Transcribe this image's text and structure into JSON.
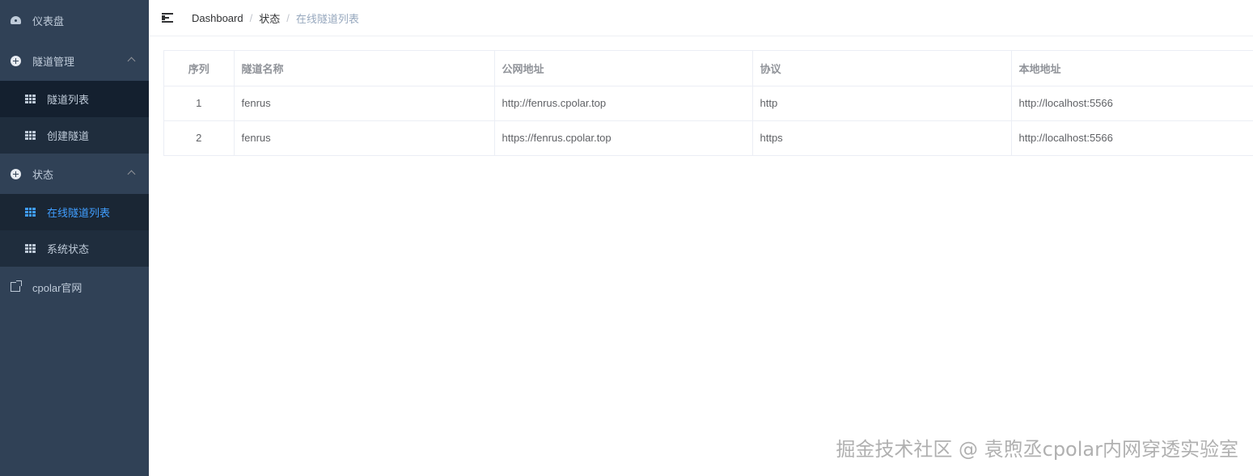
{
  "sidebar": {
    "dashboard": {
      "label": "仪表盘",
      "icon": "dashboard-gauge-icon"
    },
    "tunnel_mgmt": {
      "label": "隧道管理",
      "icon": "plus-circle-icon",
      "items": [
        {
          "label": "隧道列表",
          "icon": "grid-icon"
        },
        {
          "label": "创建隧道",
          "icon": "grid-icon"
        }
      ]
    },
    "status": {
      "label": "状态",
      "icon": "plus-circle-icon",
      "items": [
        {
          "label": "在线隧道列表",
          "icon": "grid-icon",
          "active": true
        },
        {
          "label": "系统状态",
          "icon": "grid-icon"
        }
      ]
    },
    "official_site": {
      "label": "cpolar官网",
      "icon": "external-link-icon"
    },
    "colors": {
      "background": "#304156",
      "submenu_bg": "#1f2d3d",
      "text": "#bfcbd9",
      "active": "#409eff"
    }
  },
  "header": {
    "toggle_icon": "hamburger-menu-icon",
    "breadcrumb": [
      "Dashboard",
      "状态",
      "在线隧道列表"
    ],
    "separator": "/"
  },
  "table": {
    "columns": [
      "序列",
      "隧道名称",
      "公网地址",
      "协议",
      "本地地址"
    ],
    "rows": [
      {
        "index": "1",
        "name": "fenrus",
        "public_url": "http://fenrus.cpolar.top",
        "protocol": "http",
        "local_addr": "http://localhost:5566"
      },
      {
        "index": "2",
        "name": "fenrus",
        "public_url": "https://fenrus.cpolar.top",
        "protocol": "https",
        "local_addr": "http://localhost:5566"
      }
    ]
  },
  "watermark": "掘金技术社区 @ 袁煦丞cpolar内网穿透实验室"
}
